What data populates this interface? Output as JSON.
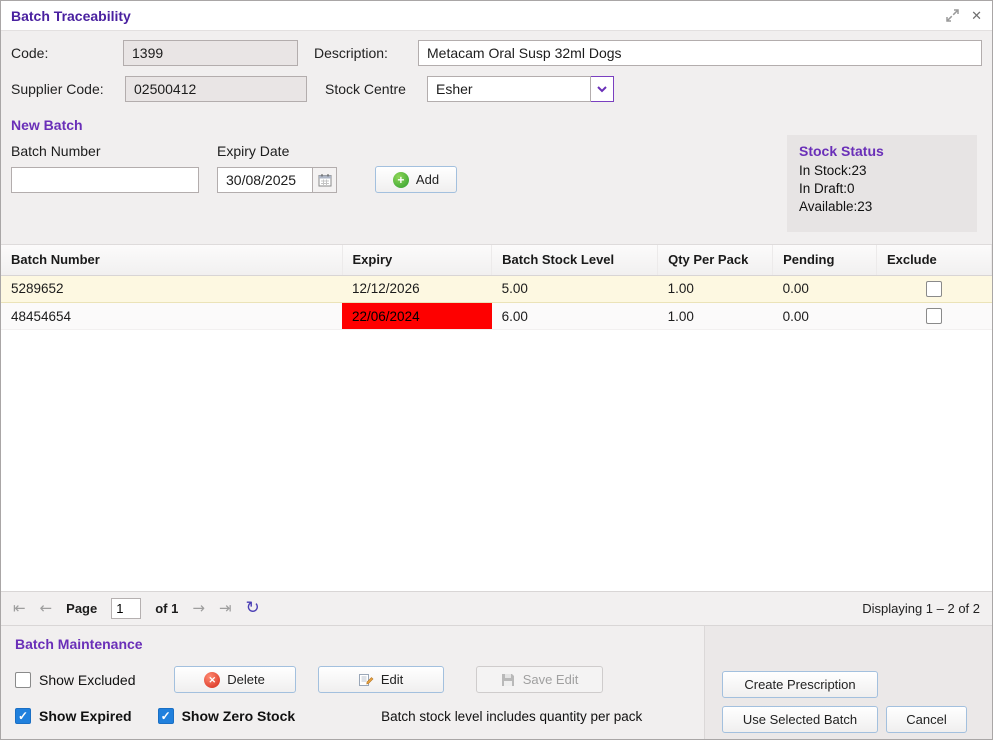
{
  "window": {
    "title": "Batch Traceability"
  },
  "icons": {
    "close": "✕",
    "first": "⇤",
    "prev": "←",
    "next": "→",
    "last": "⇥",
    "refresh": "↻"
  },
  "header": {
    "code_label": "Code:",
    "code_value": "1399",
    "description_label": "Description:",
    "description_value": "Metacam Oral Susp 32ml Dogs",
    "supplier_code_label": "Supplier Code:",
    "supplier_code_value": "02500412",
    "stock_centre_label": "Stock Centre",
    "stock_centre_value": "Esher"
  },
  "new_batch": {
    "heading": "New Batch",
    "batch_number_label": "Batch Number",
    "batch_number_value": "",
    "expiry_date_label": "Expiry Date",
    "expiry_date_value": "30/08/2025",
    "add_label": "Add"
  },
  "stock_status": {
    "heading": "Stock Status",
    "in_stock": "In Stock:23",
    "in_draft": "In Draft:0",
    "available": "Available:23"
  },
  "table": {
    "columns": [
      "Batch Number",
      "Expiry",
      "Batch Stock Level",
      "Qty Per Pack",
      "Pending",
      "Exclude"
    ],
    "rows": [
      {
        "batch_number": "5289652",
        "expiry": "12/12/2026",
        "stock_level": "5.00",
        "qty_per_pack": "1.00",
        "pending": "0.00",
        "expired": false,
        "selected": true,
        "excluded": false
      },
      {
        "batch_number": "48454654",
        "expiry": "22/06/2024",
        "stock_level": "6.00",
        "qty_per_pack": "1.00",
        "pending": "0.00",
        "expired": true,
        "selected": false,
        "excluded": false
      }
    ]
  },
  "pagination": {
    "page_label": "Page",
    "page_value": "1",
    "of_label": "of 1",
    "displaying": "Displaying 1 – 2 of 2"
  },
  "maintenance": {
    "heading": "Batch Maintenance",
    "show_excluded_label": "Show Excluded",
    "show_excluded_checked": false,
    "delete_label": "Delete",
    "edit_label": "Edit",
    "save_edit_label": "Save Edit",
    "show_expired_label": "Show Expired",
    "show_expired_checked": true,
    "show_zero_stock_label": "Show Zero Stock",
    "show_zero_stock_checked": true,
    "note": "Batch stock level includes quantity per pack",
    "create_prescription_label": "Create Prescription",
    "use_selected_batch_label": "Use Selected Batch",
    "cancel_label": "Cancel"
  }
}
